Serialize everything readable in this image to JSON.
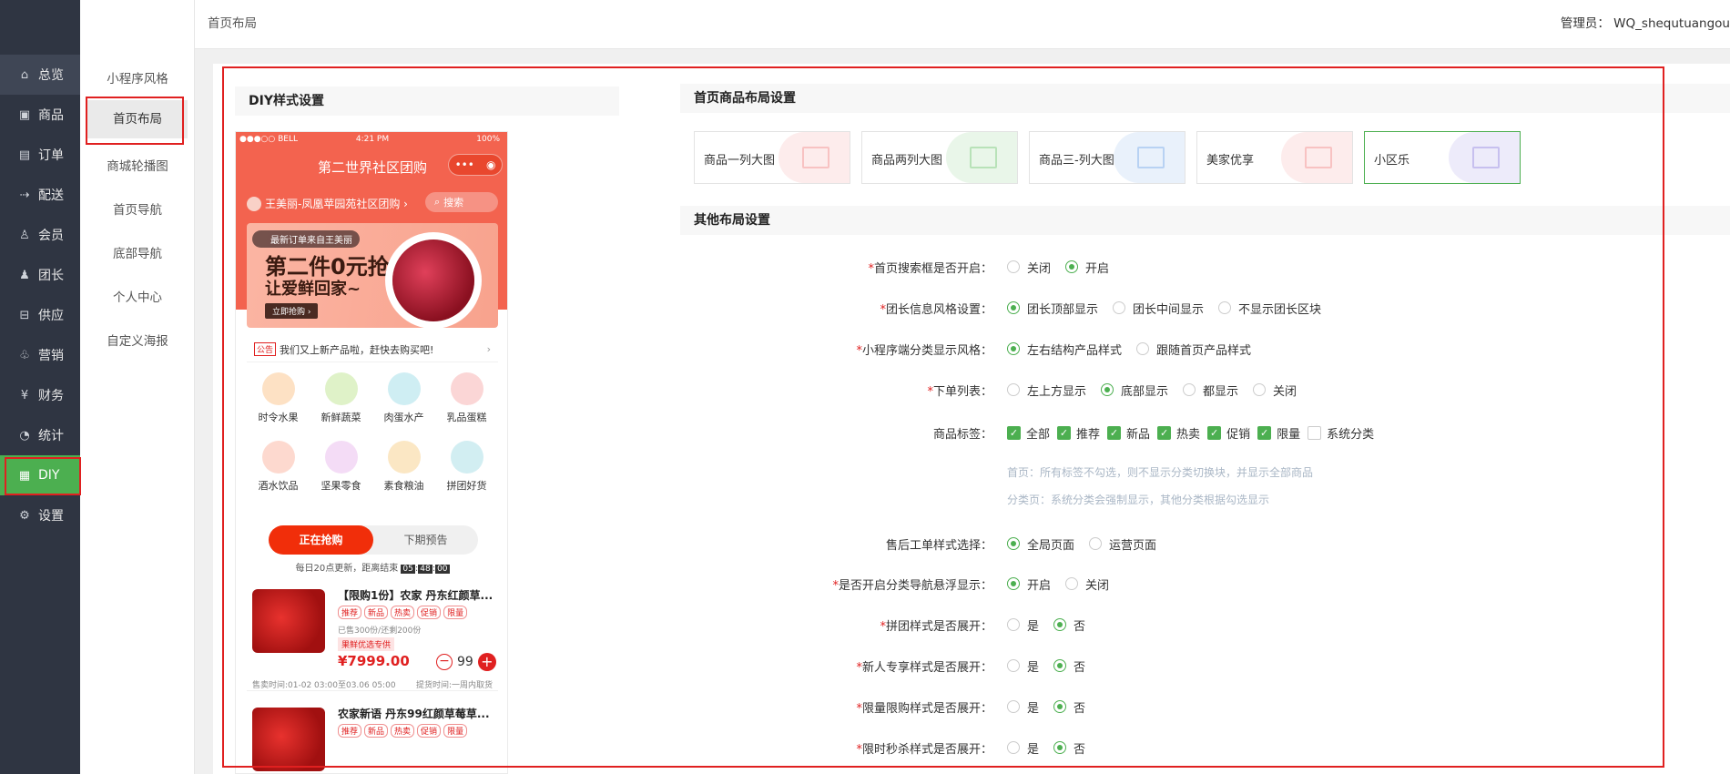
{
  "sidebar": {
    "items": [
      {
        "label": "总览",
        "icon": "home-icon"
      },
      {
        "label": "商品",
        "icon": "box-icon"
      },
      {
        "label": "订单",
        "icon": "order-icon"
      },
      {
        "label": "配送",
        "icon": "delivery-icon"
      },
      {
        "label": "会员",
        "icon": "user-icon"
      },
      {
        "label": "团长",
        "icon": "leader-icon"
      },
      {
        "label": "供应",
        "icon": "supply-icon"
      },
      {
        "label": "营销",
        "icon": "gift-icon"
      },
      {
        "label": "财务",
        "icon": "finance-icon"
      },
      {
        "label": "统计",
        "icon": "chart-icon"
      },
      {
        "label": "DIY",
        "icon": "layout-icon"
      },
      {
        "label": "设置",
        "icon": "gear-icon"
      }
    ]
  },
  "subnav": {
    "items": [
      "小程序风格",
      "首页布局",
      "商城轮播图",
      "首页导航",
      "底部导航",
      "个人中心",
      "自定义海报"
    ]
  },
  "header": {
    "breadcrumb": "首页布局",
    "admin": "管理员： WQ_shequtuangou"
  },
  "diy": {
    "title": "DIY样式设置"
  },
  "phone": {
    "status_left": "●●●○○ BELL",
    "status_time": "4:21 PM",
    "status_right": "100%",
    "title": "第二世界社区团购",
    "leader": "王美丽-凤凰苹园苑社区团购 ›",
    "search": "搜索",
    "banner_tag": "最新订单来自王美丽",
    "banner_big": "第二件0元抢",
    "banner_sub": "让爱鲜回家~",
    "banner_btn": "立即抢购 ›",
    "notice_tag": "公告",
    "notice": "我们又上新产品啦，赶快去购买吧!",
    "categories": [
      {
        "label": "时令水果",
        "color": "#fde1c4"
      },
      {
        "label": "新鲜蔬菜",
        "color": "#dff2c8"
      },
      {
        "label": "肉蛋水产",
        "color": "#cfeef3"
      },
      {
        "label": "乳品蛋糕",
        "color": "#fbd6d6"
      },
      {
        "label": "酒水饮品",
        "color": "#fdd9cf"
      },
      {
        "label": "坚果零食",
        "color": "#f4dcf6"
      },
      {
        "label": "素食粮油",
        "color": "#fbe7c4"
      },
      {
        "label": "拼团好货",
        "color": "#d2eef2"
      }
    ],
    "tab_on": "正在抢购",
    "tab_off": "下期预告",
    "countdown_prefix": "每日20点更新，距离结束",
    "countdown": [
      "05",
      "48",
      "00"
    ],
    "products": [
      {
        "title": "【限购1份】农家 丹东红颜草...",
        "tags": [
          "推荐",
          "新品",
          "热卖",
          "促销",
          "限量"
        ],
        "sold": "已售300份/还剩200份",
        "vip": "果鲜优选专供",
        "price": "¥7999.00",
        "qty": "99",
        "foot_left": "售卖时间:01-02 03:00至03.06 05:00",
        "foot_right": "提货时间:一周内取货"
      },
      {
        "title": "农家新语 丹东99红颜草莓草...",
        "tags": [
          "推荐",
          "新品",
          "热卖",
          "促销",
          "限量"
        ]
      }
    ]
  },
  "layout": {
    "title": "首页商品布局设置",
    "options": [
      {
        "label": "商品一列大图",
        "color": "#f4a0a0"
      },
      {
        "label": "商品两列大图",
        "color": "#8fd18f"
      },
      {
        "label": "商品三-列大图",
        "color": "#8fb8ec"
      },
      {
        "label": "美家优享",
        "color": "#f4a0a0"
      },
      {
        "label": "小区乐",
        "color": "#a79ce6"
      }
    ]
  },
  "other": {
    "title": "其他布局设置",
    "rows": [
      {
        "label": "首页搜索框是否开启：",
        "req": "*",
        "options": [
          "关闭",
          "开启"
        ],
        "selected": 1
      },
      {
        "label": "团长信息风格设置：",
        "req": "*",
        "options": [
          "团长顶部显示",
          "团长中间显示",
          "不显示团长区块"
        ],
        "selected": 0
      },
      {
        "label": "小程序端分类显示风格：",
        "req": "*",
        "options": [
          "左右结构产品样式",
          "跟随首页产品样式"
        ],
        "selected": 0
      },
      {
        "label": "下单列表：",
        "req": "*",
        "options": [
          "左上方显示",
          "底部显示",
          "都显示",
          "关闭"
        ],
        "selected": 1
      },
      {
        "label": "商品标签：",
        "req": "",
        "options": [
          "全部",
          "推荐",
          "新品",
          "热卖",
          "促销",
          "限量",
          "系统分类"
        ],
        "checks": [
          true,
          true,
          true,
          true,
          true,
          true,
          false
        ]
      },
      {
        "label": "售后工单样式选择：",
        "req": "",
        "options": [
          "全局页面",
          "运营页面"
        ],
        "selected": 0
      },
      {
        "label": "是否开启分类导航悬浮显示：",
        "req": "*",
        "options": [
          "开启",
          "关闭"
        ],
        "selected": 0
      },
      {
        "label": "拼团样式是否展开：",
        "req": "*",
        "options": [
          "是",
          "否"
        ],
        "selected": 1
      },
      {
        "label": "新人专享样式是否展开：",
        "req": "*",
        "options": [
          "是",
          "否"
        ],
        "selected": 1
      },
      {
        "label": "限量限购样式是否展开：",
        "req": "*",
        "options": [
          "是",
          "否"
        ],
        "selected": 1
      },
      {
        "label": "限时秒杀样式是否展开：",
        "req": "*",
        "options": [
          "是",
          "否"
        ],
        "selected": 1
      }
    ],
    "hint1": "首页：所有标签不勾选，则不显示分类切换块，并显示全部商品",
    "hint2": "分类页：系统分类会强制显示，其他分类根据勾选显示"
  },
  "colors": {
    "accent": "#4caf50",
    "highlight": "#e02020",
    "phone_red": "#f3634f"
  }
}
